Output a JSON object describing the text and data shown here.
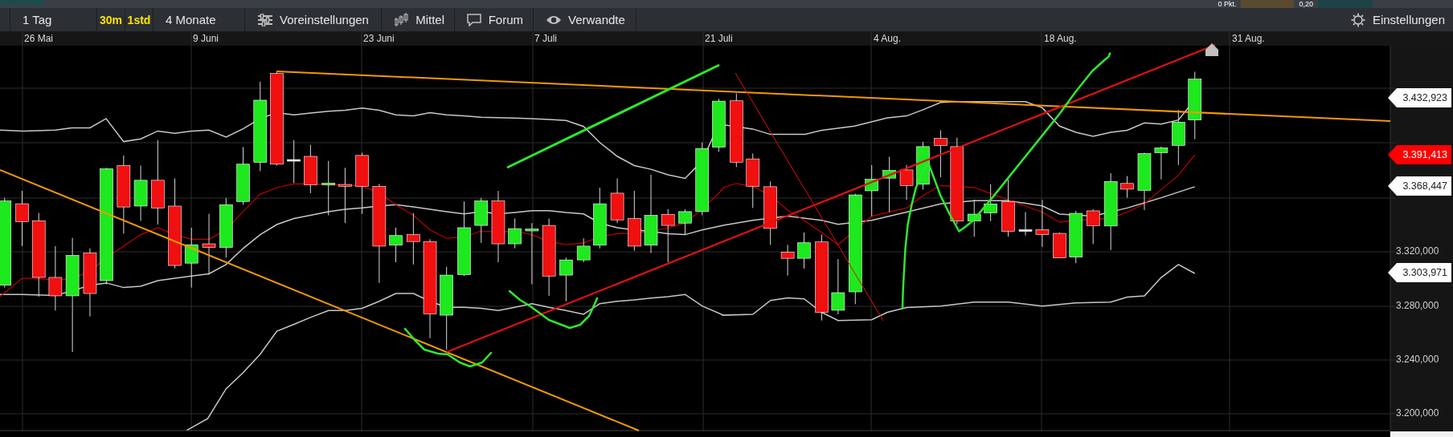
{
  "top_strip": {
    "points_label": "0 Pkt.",
    "value": "0,20"
  },
  "toolbar": {
    "items": [
      {
        "kind": "plain",
        "label": "1 Tag"
      },
      {
        "kind": "interval",
        "label": "30m"
      },
      {
        "kind": "interval",
        "label": "1std"
      },
      {
        "kind": "plain",
        "label": "4 Monate"
      },
      {
        "kind": "sliders",
        "label": "Voreinstellungen"
      },
      {
        "kind": "candles",
        "label": "Mittel"
      },
      {
        "kind": "bubble",
        "label": "Forum"
      },
      {
        "kind": "eye",
        "label": "Verwandte"
      }
    ],
    "settings_button": {
      "label": "Einstellungen"
    }
  },
  "chart": {
    "x_labels": [
      "26 Mai",
      "9 Juni",
      "23 Juni",
      "7 Juli",
      "21 Juli",
      "4 Aug.",
      "18 Aug.",
      "31 Aug."
    ],
    "y_labels": [
      "3.320,000",
      "3.280,000",
      "3.240,000",
      "3.200,000"
    ],
    "price_tags": [
      {
        "label": "3.432,923",
        "color": "#ffffff"
      },
      {
        "label": "3.391,413",
        "color": "#ff0000"
      },
      {
        "label": "3.368,447",
        "color": "#ffffff"
      },
      {
        "label": "3.303,971",
        "color": "#ffffff"
      }
    ]
  }
}
